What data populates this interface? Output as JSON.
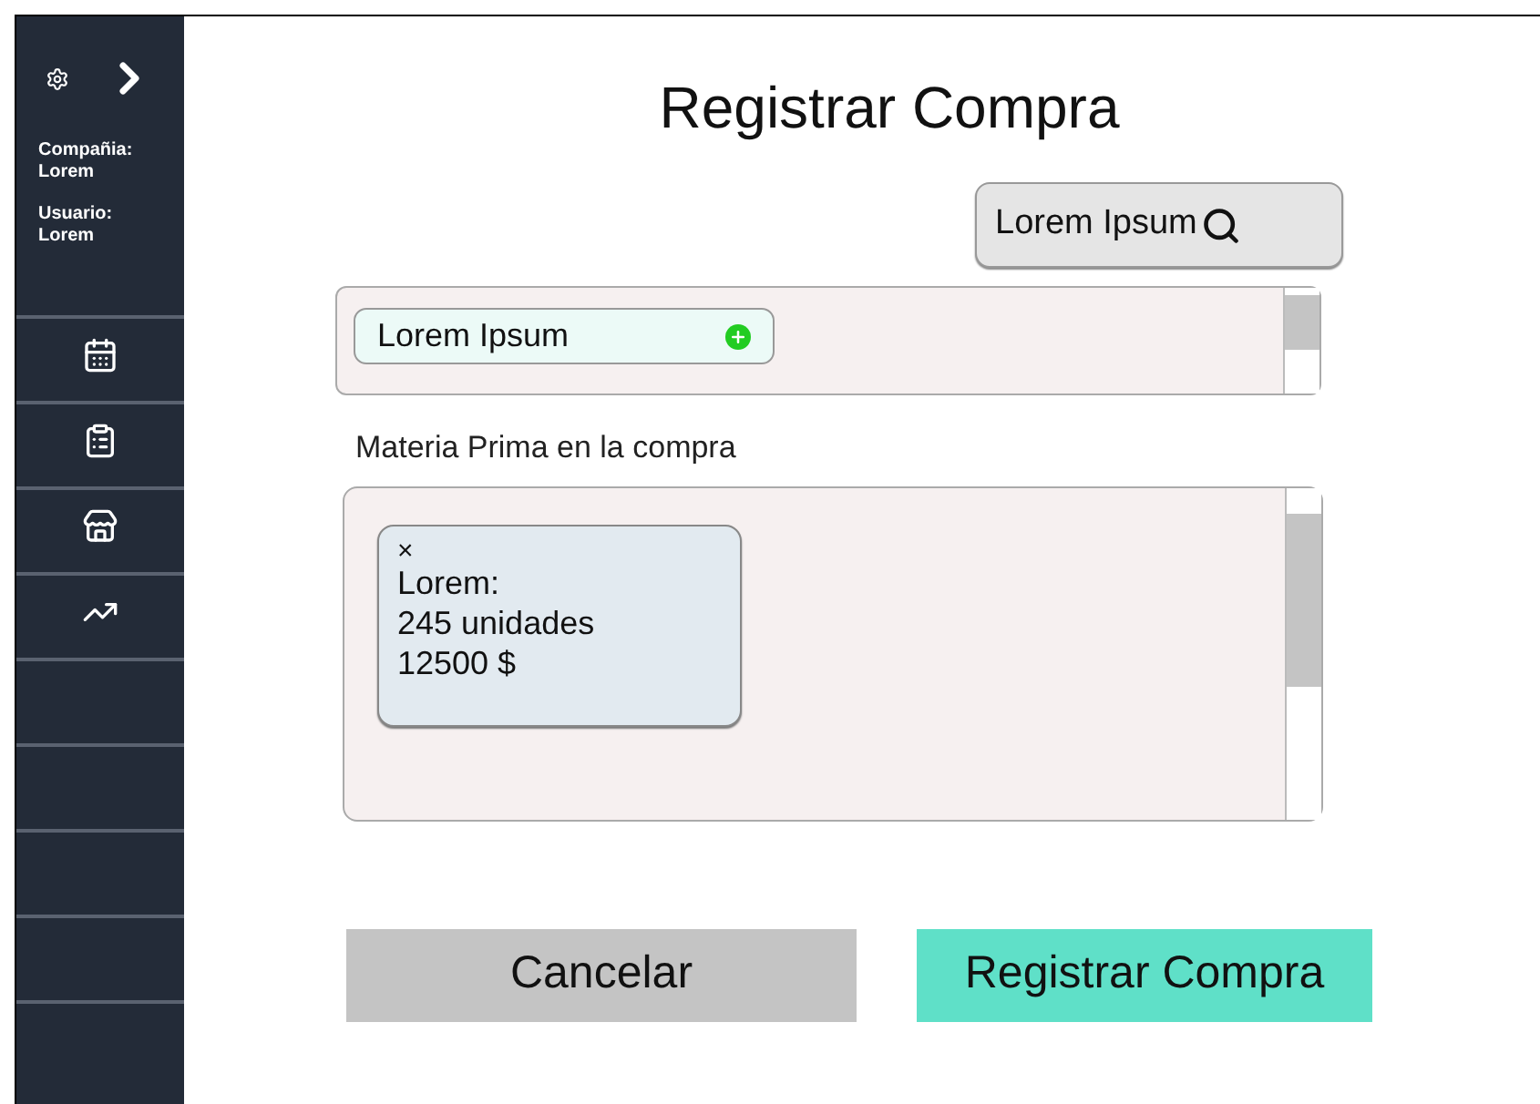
{
  "sidebar": {
    "company_label": "Compañia:",
    "company": "Lorem",
    "user_label": "Usuario:",
    "user": "Lorem",
    "items": [
      {
        "kind": "calendar"
      },
      {
        "kind": "clipboard"
      },
      {
        "kind": "store"
      },
      {
        "kind": "chart"
      }
    ]
  },
  "title": "Registrar Compra",
  "search": {
    "label": "Lorem Ipsum"
  },
  "suppliers": [
    {
      "label": "Lorem Ipsum"
    }
  ],
  "materials_label": "Materia Prima en la compra",
  "materials": [
    {
      "close": "×",
      "name": "Lorem:",
      "quantity": "245 unidades",
      "price": "12500 $"
    }
  ],
  "buttons": [
    {
      "kind": "cancel",
      "label": "Cancelar"
    },
    {
      "kind": "submit",
      "label": "Registrar Compra"
    }
  ]
}
